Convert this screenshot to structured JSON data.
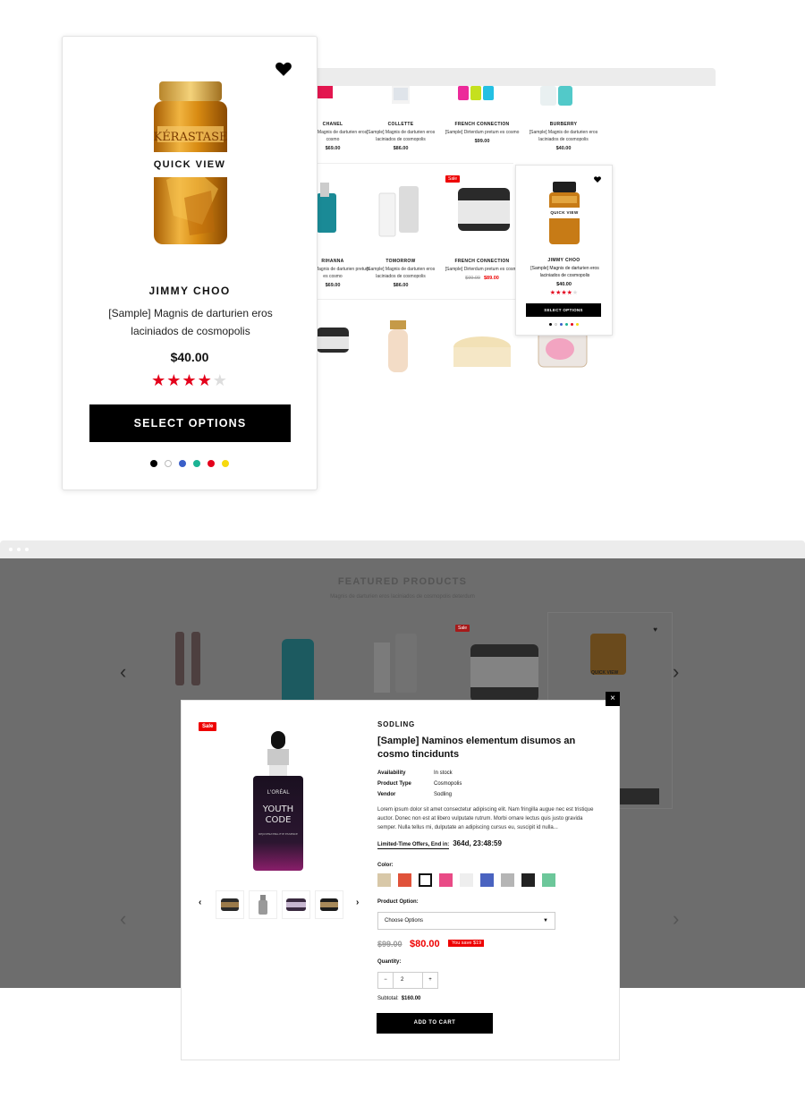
{
  "top_grid": {
    "row1": [
      {
        "brand": "CHANEL",
        "desc": "[Sample] Magnis de darturien eros cosmo",
        "price": "$69.00"
      },
      {
        "brand": "COLLETTE",
        "desc": "[Sample] Magnis de darturien eros laciniados de cosmopolis",
        "price": "$86.00"
      },
      {
        "brand": "FRENCH CONNECTION",
        "desc": "[Sample] Dirterdum pretum es cosmo",
        "price": "$99.00"
      },
      {
        "brand": "BURBERRY",
        "desc": "[Sample] Magnis de darturien eros laciniados de cosmopolis",
        "price": "$40.00"
      }
    ],
    "row2": [
      {
        "brand": "RIHANNA",
        "desc": "[Sample] Magnis de darturien pretum es cosmo",
        "price": "$69.00"
      },
      {
        "brand": "TOMORROW",
        "desc": "[Sample] Magnis de darturien eros laciniados de cosmopolis",
        "price": "$86.00"
      },
      {
        "brand": "FRENCH CONNECTION",
        "desc": "[Sample] Dirterdum pretum es cosmo",
        "old_price": "$99.00",
        "price": "$89.00",
        "badge": "Sale"
      }
    ]
  },
  "small_card": {
    "quick_view": "QUICK VIEW",
    "brand": "JIMMY CHOO",
    "desc": "[Sample] Magnis de darturien eros laciniados de cosmopolis",
    "price": "$40.00",
    "button": "SELECT OPTIONS"
  },
  "big_card": {
    "quick_view": "QUICK VIEW",
    "brand": "JIMMY CHOO",
    "desc": "[Sample] Magnis de darturien eros laciniados de cosmopolis",
    "price": "$40.00",
    "rating": 4,
    "rating_max": 5,
    "button": "SELECT OPTIONS",
    "swatches": [
      "#000000",
      "#ffffff",
      "#3a5fc8",
      "#1bb394",
      "#e4001b",
      "#f6d90f"
    ],
    "jar_label": "KÉRASTASE"
  },
  "featured": {
    "title": "FEATURED PRODUCTS",
    "subtitle": "Magnis de darturien eros laciniados de cosmopolis deterdum",
    "sale": "Sale",
    "quick_view": "QUICK VIEW"
  },
  "modal": {
    "sale": "Sale",
    "bottle_brand": "L'ORÉAL",
    "bottle_line1": "YOUTH",
    "bottle_line2": "CODE",
    "bottle_sub": "REJUVENATING EYE ESSENCE",
    "brand": "SODLING",
    "title": "[Sample] Naminos elementum disumos an cosmo tincidunts",
    "specs": [
      {
        "key": "Availability",
        "value": "In stock"
      },
      {
        "key": "Product Type",
        "value": "Cosmopolis"
      },
      {
        "key": "Vendor",
        "value": "Sodling"
      }
    ],
    "description": "Lorem ipsum dolor sit amet consectetur adipiscing elit. Nam fringilla augue nec est tristique auctor. Donec non est at libero vulputate rutrum. Morbi ornare lectus quis justo gravida semper. Nulla tellus mi, dulputate an adipiscing cursus eu, suscipit id nulla...",
    "offer_label": "Limited-Time Offers, End in:",
    "offer_time": "364d, 23:48:59",
    "color_label": "Color:",
    "colors": [
      "#d8c8a8",
      "#e0523a",
      "#ffffff",
      "#e94b86",
      "#eeeeee",
      "#4a63c0",
      "#b5b5b5",
      "#222222",
      "#6cc79a"
    ],
    "option_label": "Product Option:",
    "option_value": "Choose Options",
    "old_price": "$99.00",
    "new_price": "$80.00",
    "save_tag": "You save $19",
    "qty_label": "Quantity:",
    "qty_minus": "−",
    "qty_value": "2",
    "qty_plus": "+",
    "subtotal_label": "Subtotal:",
    "subtotal_value": "$160.00",
    "cart_button": "ADD TO CART",
    "close": "×"
  }
}
